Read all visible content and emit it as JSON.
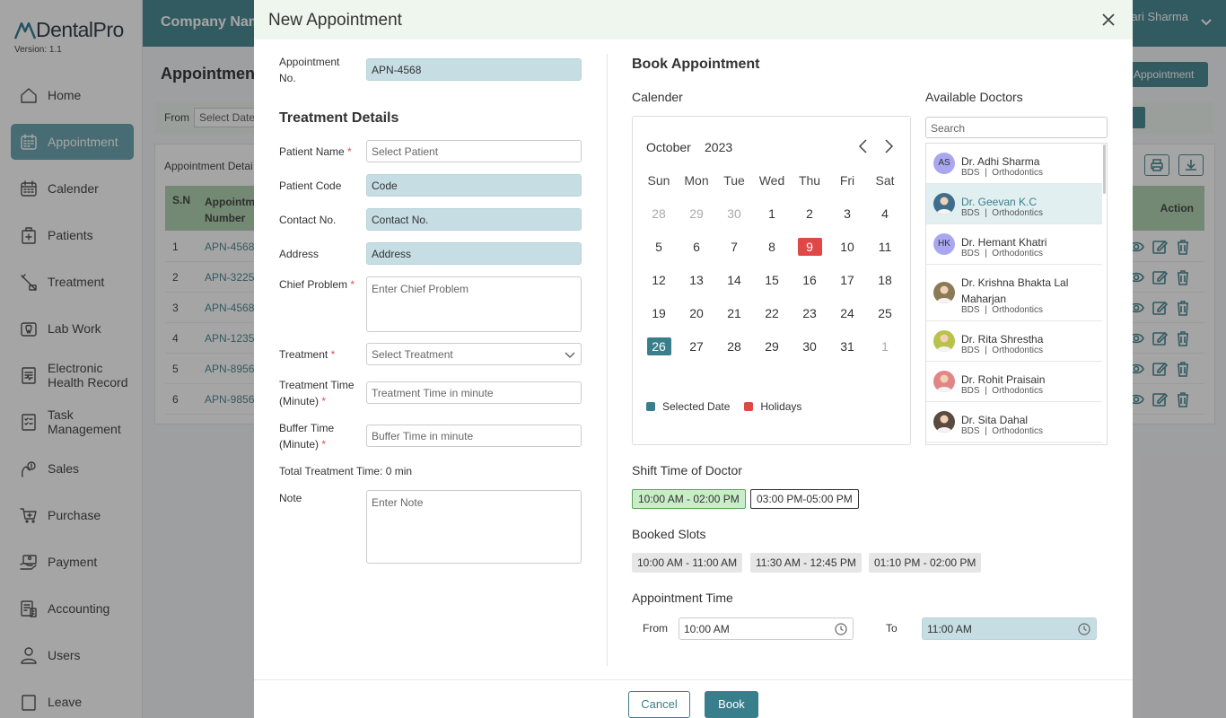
{
  "brand": {
    "name": "DentalPro",
    "version": "Version: 1.1"
  },
  "nav": [
    {
      "label": "Home",
      "icon": "home-icon"
    },
    {
      "label": "Appointment",
      "icon": "calendar-grid-icon",
      "active": true
    },
    {
      "label": "Calender",
      "icon": "calendar-icon"
    },
    {
      "label": "Patients",
      "icon": "patient-icon"
    },
    {
      "label": "Treatment",
      "icon": "treatment-icon"
    },
    {
      "label": "Lab Work",
      "icon": "lab-icon"
    },
    {
      "label": "Electronic Health Record",
      "icon": "health-record-icon"
    },
    {
      "label": "Task Management",
      "icon": "task-icon"
    },
    {
      "label": "Sales",
      "icon": "sales-icon"
    },
    {
      "label": "Purchase",
      "icon": "cart-icon"
    },
    {
      "label": "Payment",
      "icon": "payment-icon"
    },
    {
      "label": "Accounting",
      "icon": "accounting-icon"
    },
    {
      "label": "Users",
      "icon": "user-icon"
    },
    {
      "label": "Leave",
      "icon": "leave-icon"
    }
  ],
  "topbar": {
    "company": "Company Nam",
    "user": "ari Sharma"
  },
  "background": {
    "page_title": "Appointment",
    "add_button": "Appointment",
    "filter_from": "From",
    "filter_date_placeholder": "Select Date",
    "details_label": "Appointment Detai",
    "table_headers": {
      "sn": "S.N",
      "number": "Appointme Number",
      "action": "Action"
    },
    "rows": [
      {
        "sn": "1",
        "num": "APN-4568"
      },
      {
        "sn": "2",
        "num": "APN-3225"
      },
      {
        "sn": "3",
        "num": "APN-4568"
      },
      {
        "sn": "4",
        "num": "APN-1235"
      },
      {
        "sn": "5",
        "num": "APN-8956"
      },
      {
        "sn": "6",
        "num": "APN-9856"
      }
    ]
  },
  "modal": {
    "title": "New Appointment",
    "appointment_no_label": "Appointment No.",
    "appointment_no": "APN-4568",
    "treatment_details_title": "Treatment Details",
    "fields": {
      "patient_name": {
        "label": "Patient Name",
        "placeholder": "Select Patient"
      },
      "patient_code": {
        "label": "Patient Code",
        "value": "Code"
      },
      "contact_no": {
        "label": "Contact No.",
        "value": "Contact No."
      },
      "address": {
        "label": "Address",
        "value": "Address"
      },
      "chief_problem": {
        "label": "Chief Problem",
        "placeholder": "Enter Chief Problem"
      },
      "treatment": {
        "label": "Treatment",
        "placeholder": "Select Treatment"
      },
      "treatment_time": {
        "label": "Treatment Time (Minute)",
        "placeholder": "Treatment Time in minute"
      },
      "buffer_time": {
        "label": "Buffer Time (Minute)",
        "placeholder": "Buffer Time in minute"
      },
      "note": {
        "label": "Note",
        "placeholder": "Enter Note"
      }
    },
    "required_mark": "*",
    "total_time_label": "Total Treatment Time:",
    "total_time_value": "0 min",
    "book_title": "Book Appointment",
    "calendar_label": "Calender",
    "calendar": {
      "month": "October",
      "year": "2023",
      "dow": [
        "Sun",
        "Mon",
        "Tue",
        "Wed",
        "Thu",
        "Fri",
        "Sat"
      ],
      "weeks": [
        [
          {
            "d": "28",
            "m": true
          },
          {
            "d": "29",
            "m": true
          },
          {
            "d": "30",
            "m": true
          },
          {
            "d": "1"
          },
          {
            "d": "2"
          },
          {
            "d": "3"
          },
          {
            "d": "4"
          }
        ],
        [
          {
            "d": "5"
          },
          {
            "d": "6"
          },
          {
            "d": "7"
          },
          {
            "d": "8"
          },
          {
            "d": "9",
            "h": true
          },
          {
            "d": "10"
          },
          {
            "d": "11"
          }
        ],
        [
          {
            "d": "12"
          },
          {
            "d": "13"
          },
          {
            "d": "14"
          },
          {
            "d": "15"
          },
          {
            "d": "16"
          },
          {
            "d": "17"
          },
          {
            "d": "18"
          }
        ],
        [
          {
            "d": "19"
          },
          {
            "d": "20"
          },
          {
            "d": "21"
          },
          {
            "d": "22"
          },
          {
            "d": "23"
          },
          {
            "d": "24"
          },
          {
            "d": "25"
          }
        ],
        [
          {
            "d": "26",
            "s": true
          },
          {
            "d": "27"
          },
          {
            "d": "28"
          },
          {
            "d": "29"
          },
          {
            "d": "30"
          },
          {
            "d": "31"
          },
          {
            "d": "1",
            "m": true
          }
        ]
      ],
      "legend_selected": "Selected Date",
      "legend_holidays": "Holidays",
      "selected_color": "#397f8b",
      "holiday_color": "#e04848"
    },
    "doctors_title": "Available Doctors",
    "doctor_search_placeholder": "Search",
    "doctors": [
      {
        "name": "Dr. Adhi Sharma",
        "initials": "AS",
        "degree": "BDS",
        "specialty": "Orthodontics",
        "avatar_color": "#a9a7f0"
      },
      {
        "name": "Dr. Geevan K.C",
        "initials": "",
        "degree": "BDS",
        "specialty": "Orthodontics",
        "avatar_color": "#3e6e8c",
        "active": true
      },
      {
        "name": "Dr. Hemant Khatri",
        "initials": "HK",
        "degree": "BDS",
        "specialty": "Orthodontics",
        "avatar_color": "#a9a7f0"
      },
      {
        "name": "Dr. Krishna Bhakta Lal Maharjan",
        "initials": "",
        "degree": "BDS",
        "specialty": "Orthodontics",
        "avatar_color": "#8a7a55"
      },
      {
        "name": "Dr. Rita Shrestha",
        "initials": "",
        "degree": "BDS",
        "specialty": "Orthodontics",
        "avatar_color": "#b9c24a"
      },
      {
        "name": "Dr. Rohit Praisain",
        "initials": "",
        "degree": "BDS",
        "specialty": "Orthodontics",
        "avatar_color": "#e08686"
      },
      {
        "name": "Dr. Sita Dahal",
        "initials": "",
        "degree": "BDS",
        "specialty": "Orthodontics",
        "avatar_color": "#5a4a40"
      }
    ],
    "meta_separator": "|",
    "shift_title": "Shift Time of Doctor",
    "shifts": [
      "10:00 AM - 02:00 PM",
      "03:00 PM-05:00 PM"
    ],
    "booked_title": "Booked Slots",
    "booked_slots": [
      "10:00 AM - 11:00 AM",
      "11:30 AM - 12:45 PM",
      "01:10 PM - 02:00 PM"
    ],
    "appointment_time_title": "Appointment Time",
    "time_from_label": "From",
    "time_from": "10:00 AM",
    "time_to_label": "To",
    "time_to": "11:00 AM",
    "cancel_label": "Cancel",
    "book_label": "Book"
  }
}
